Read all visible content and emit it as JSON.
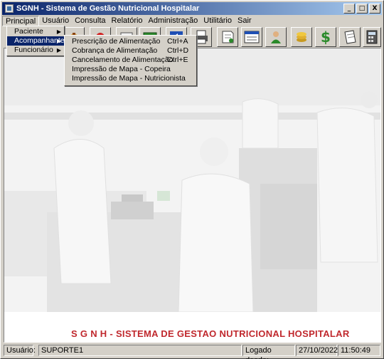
{
  "window": {
    "title": "SGNH - Sistema de Gestão Nutricional Hospitalar"
  },
  "window_buttons": [
    "_",
    "□",
    "X"
  ],
  "menubar": [
    "Principal",
    "Usuário",
    "Consulta",
    "Relatório",
    "Administração",
    "Utilitário",
    "Sair"
  ],
  "principal_menu": [
    {
      "label": "Paciente",
      "has_submenu": true
    },
    {
      "label": "Acompanhante",
      "has_submenu": true,
      "selected": true
    },
    {
      "label": "Funcionário",
      "has_submenu": true
    }
  ],
  "submenu": [
    {
      "label": "Prescrição de Alimentação",
      "shortcut": "Ctrl+A"
    },
    {
      "label": "Cobrança de Alimentação",
      "shortcut": "Ctrl+D"
    },
    {
      "label": "Cancelamento de Alimentação",
      "shortcut": "Ctrl+E"
    },
    {
      "label": "Impressão de Mapa - Copeira",
      "shortcut": ""
    },
    {
      "label": "Impressão de Mapa - Nutricionista",
      "shortcut": ""
    }
  ],
  "toolbar_icons": [
    "food-icon",
    "stop-icon",
    "photo-icon",
    "spreadsheet-icon",
    "arrow-icon",
    "printer-icon",
    "note-icon",
    "form-icon",
    "user-icon",
    "coins-icon",
    "dollar-icon",
    "document-icon",
    "calculator-icon"
  ],
  "banner": {
    "text": "S G N H  -  SISTEMA DE GESTAO NUTRICIONAL HOSPITALAR",
    "color": "#c0282d"
  },
  "status": {
    "user_label": "Usuário:",
    "user_value": "SUPORTE1",
    "login_label": "Logado desde:",
    "date": "27/10/2022",
    "time": "11:50:49"
  },
  "colors": {
    "titlebar_start": "#0a246a",
    "titlebar_end": "#a6caf0",
    "selection": "#0a246a"
  }
}
